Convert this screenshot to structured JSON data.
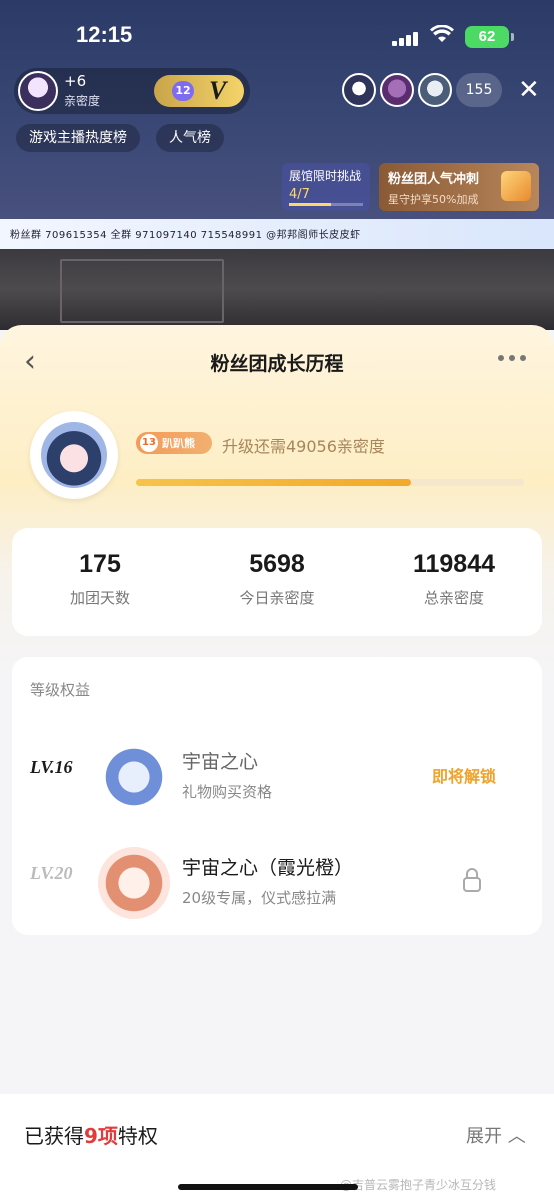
{
  "status_bar": {
    "time": "12:15",
    "battery": "62"
  },
  "live": {
    "anchor_plus": "+6",
    "anchor_intimacy_label": "亲密度",
    "fan_badge_level": "12",
    "fan_badge_mark": "V",
    "viewer_count": "155",
    "rank_tabs": [
      "游戏主播热度榜",
      "人气榜"
    ],
    "challenge_title": "展馆限时挑战",
    "challenge_progress": "4/7",
    "fan_sprint_title": "粉丝团人气冲刺",
    "fan_sprint_sub": "星守护享50%加成",
    "banner_text": "粉丝群 709615354 全群 971097140   715548991   @邦邦阁师长皮皮虾"
  },
  "panel": {
    "title": "粉丝团成长历程",
    "level_badge_num": "13",
    "level_badge_name": "趴趴熊",
    "upgrade_text": "升级还需49056亲密度",
    "progress": 0.71,
    "stats": [
      {
        "value": "175",
        "label": "加团天数"
      },
      {
        "value": "5698",
        "label": "今日亲密度"
      },
      {
        "value": "119844",
        "label": "总亲密度"
      }
    ],
    "benefits_title": "等级权益",
    "benefits": [
      {
        "level": "LV.16",
        "name": "宇宙之心",
        "desc": "礼物购买资格",
        "status": "即将解锁"
      },
      {
        "level": "LV.20",
        "name": "宇宙之心（霞光橙）",
        "desc": "20级专属，仪式感拉满",
        "status": ""
      }
    ]
  },
  "bottom": {
    "prefix": "已获得",
    "highlight": "9项",
    "suffix": "特权",
    "expand": "展开",
    "watermark": "@吉普云雾抱子青少冰互分钱"
  },
  "colors": {
    "accent": "#f0a22a",
    "highlight": "#e23b3b",
    "progress": "#f2a92c"
  }
}
